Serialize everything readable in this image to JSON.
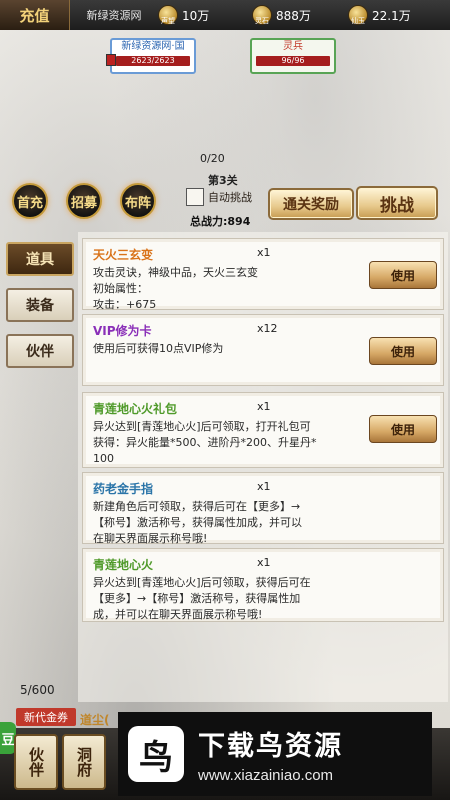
{
  "topbar": {
    "logo": "充值",
    "site": "新绿资源网",
    "stats": [
      {
        "icon": "gold-ingot-icon",
        "tag": "声望",
        "value": "10万"
      },
      {
        "icon": "coin-icon",
        "tag": "灵石",
        "value": "888万"
      },
      {
        "icon": "treasure-icon",
        "tag": "仙玉",
        "value": "22.1万"
      }
    ]
  },
  "battle": {
    "player": {
      "name": "新绿资源网·国",
      "hp": "2623/2623"
    },
    "enemy": {
      "name": "灵兵",
      "hp": "96/96"
    },
    "progress": "0/20",
    "stage": "第3关",
    "auto_label": "自动挑战",
    "power_label": "总战力:",
    "power_value": "894",
    "skills": [
      "首充",
      "招募",
      "布阵"
    ],
    "reward_button": "通关奖励",
    "challenge_button": "挑战"
  },
  "tabs": [
    "道具",
    "装备",
    "伙伴"
  ],
  "items": [
    {
      "name": "天火三玄变",
      "count": "x1",
      "desc": [
        "攻击灵诀，神级中品，天火三玄变",
        "初始属性：",
        "攻击：+675"
      ],
      "use": "使用",
      "color": "#d9731a"
    },
    {
      "name": "VIP修为卡",
      "count": "x12",
      "desc": [
        "使用后可获得10点VIP修为"
      ],
      "use": "使用",
      "color": "#8a2fb8"
    },
    {
      "name": "青莲地心火礼包",
      "count": "x1",
      "desc": [
        "异火达到[青莲地心火]后可领取，打开礼包可",
        "获得：异火能量*500、进阶丹*200、升星丹*",
        "100"
      ],
      "use": "使用",
      "color": "#4f9a2a"
    },
    {
      "name": "药老金手指",
      "count": "x1",
      "desc": [
        "新建角色后可领取，获得后可在【更多】→",
        "【称号】激活称号，获得属性加成，并可以",
        "在聊天界面展示称号哦!"
      ],
      "use": "",
      "color": "#2a74a8"
    },
    {
      "name": "青莲地心火",
      "count": "x1",
      "desc": [
        "异火达到[青莲地心火]后可领取，获得后可在",
        "【更多】→【称号】激活称号，获得属性加",
        "成，并可以在聊天界面展示称号哦!"
      ],
      "use": "",
      "color": "#4f9a2a"
    }
  ],
  "page_count": "5/600",
  "bottom": {
    "coupon": "新代金券",
    "partial_title": "道尘(",
    "green_edge": "豆",
    "nav": [
      "伙伴",
      "洞府"
    ]
  },
  "watermark": {
    "logo_glyph": "鸟",
    "title": "下载鸟资源",
    "url": "www.xiazainiao.com"
  }
}
